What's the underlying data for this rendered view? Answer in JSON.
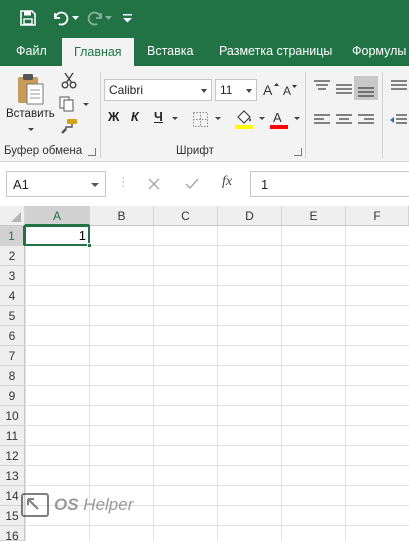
{
  "quick_access": {
    "save_icon": "save-icon",
    "undo_icon": "undo-icon",
    "redo_icon": "redo-icon",
    "customize_icon": "customize-qat-icon"
  },
  "ribbon_tabs": [
    {
      "label": "Файл"
    },
    {
      "label": "Главная",
      "active": true
    },
    {
      "label": "Вставка"
    },
    {
      "label": "Разметка страницы"
    },
    {
      "label": "Формулы"
    }
  ],
  "clipboard": {
    "paste_label": "Вставить",
    "group_label": "Буфер обмена"
  },
  "font": {
    "font_name": "Calibri",
    "font_size": "11",
    "bold": "Ж",
    "italic": "К",
    "underline": "Ч",
    "group_label": "Шрифт",
    "highlight_color": "#ffff00",
    "font_color": "#ff0000"
  },
  "formula_bar": {
    "name_box": "A1",
    "fx_label": "fx",
    "content": "1"
  },
  "grid": {
    "columns": [
      "A",
      "B",
      "C",
      "D",
      "E",
      "F"
    ],
    "rows": [
      "1",
      "2",
      "3",
      "4",
      "5",
      "6",
      "7",
      "8",
      "9",
      "10",
      "11",
      "12",
      "13",
      "14",
      "15",
      "16"
    ],
    "selected_cell": "A1",
    "cells": [
      {
        "ref": "A1",
        "value": "1"
      }
    ]
  },
  "watermark": {
    "text_a": "OS",
    "text_b": "Helper"
  },
  "colors": {
    "accent": "#217346",
    "ribbon_bg": "#f3f3f3"
  }
}
